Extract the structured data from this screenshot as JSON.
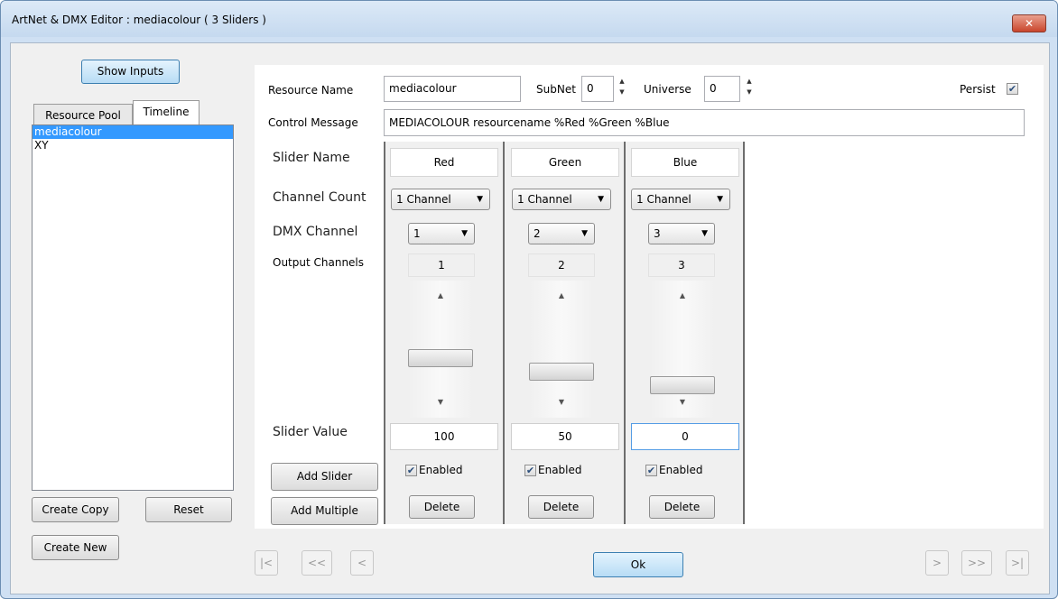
{
  "window": {
    "title": "ArtNet & DMX Editor : mediacolour ( 3 Sliders )",
    "close_label": "✕"
  },
  "left": {
    "show_inputs": "Show Inputs",
    "tabs": [
      {
        "label": "Resource Pool"
      },
      {
        "label": "Timeline"
      }
    ],
    "items": [
      {
        "label": "mediacolour"
      },
      {
        "label": "XY"
      }
    ],
    "create_copy": "Create Copy",
    "reset": "Reset",
    "create_new": "Create New"
  },
  "form": {
    "resource_name_label": "Resource Name",
    "resource_name_value": "mediacolour",
    "subnet_label": "SubNet",
    "subnet_value": "0",
    "universe_label": "Universe",
    "universe_value": "0",
    "persist_label": "Persist",
    "persist_checked": true,
    "control_message_label": "Control Message",
    "control_message_value": "MEDIACOLOUR resourcename %Red %Green %Blue"
  },
  "row_labels": {
    "slider_name": "Slider Name",
    "channel_count": "Channel Count",
    "dmx_channel": "DMX Channel",
    "output_channels": "Output Channels",
    "slider_value": "Slider Value"
  },
  "actions": {
    "add_slider": "Add Slider",
    "add_multiple": "Add Multiple"
  },
  "sliders": [
    {
      "name": "Red",
      "channel_count": "1 Channel",
      "dmx_channel": "1",
      "output_channels": "1",
      "value": "100",
      "level": 1.0,
      "enabled_label": "Enabled",
      "enabled": true,
      "delete_label": "Delete"
    },
    {
      "name": "Green",
      "channel_count": "1 Channel",
      "dmx_channel": "2",
      "output_channels": "2",
      "value": "50",
      "level": 0.5,
      "enabled_label": "Enabled",
      "enabled": true,
      "delete_label": "Delete"
    },
    {
      "name": "Blue",
      "channel_count": "1 Channel",
      "dmx_channel": "3",
      "output_channels": "3",
      "value": "0",
      "level": 0.0,
      "enabled_label": "Enabled",
      "enabled": true,
      "delete_label": "Delete"
    }
  ],
  "bottom": {
    "first": "|<",
    "prev_page": "<<",
    "prev": "<",
    "ok": "Ok",
    "next": ">",
    "next_page": ">>",
    "last": ">|"
  },
  "icons": {
    "check": "checkmark-icon",
    "dropdown": "dropdown-arrow-icon",
    "spin_up": "spin-up-icon",
    "spin_down": "spin-down-icon"
  },
  "colors": {
    "accent": "#3399ff",
    "title_bar": "#c5d9ef",
    "close": "#c9452d"
  }
}
